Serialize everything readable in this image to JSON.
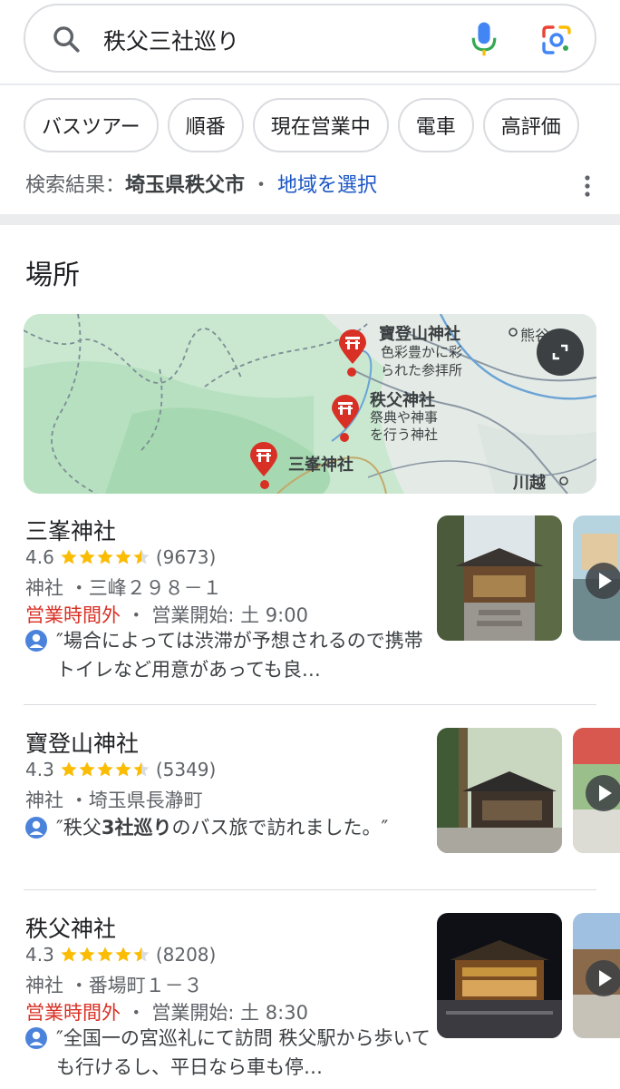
{
  "search": {
    "query": "秩父三社巡り"
  },
  "chips": [
    "バスツアー",
    "順番",
    "現在営業中",
    "電車",
    "高評価"
  ],
  "results_line": {
    "prefix": "検索結果：",
    "location": "埼玉県秩父市",
    "dot": "・",
    "link": "地域を選択"
  },
  "section_title": "場所",
  "map": {
    "pins": [
      {
        "name": "寶登山神社",
        "desc1": "色彩豊かに彩",
        "desc2": "られた参拝所"
      },
      {
        "name": "秩父神社",
        "desc1": "祭典や神事",
        "desc2": "を行う神社"
      },
      {
        "name": "三峯神社",
        "desc1": "",
        "desc2": ""
      }
    ],
    "labels": {
      "kumagaya": "熊谷",
      "kawagoe": "川越"
    },
    "colors": {
      "land": "#c9e8cf",
      "forest": "#a8dbb3",
      "urban": "#e6ece9",
      "pin": "#d93025"
    }
  },
  "listings": [
    {
      "name": "三峯神社",
      "rating": "4.6",
      "stars": 4.5,
      "count": "(9673)",
      "category": "神社",
      "sep": "・",
      "address": "三峰２９８－１",
      "status": "営業時間外",
      "hours_sep": "・",
      "hours": "営業開始: 土 9:00",
      "review": "″場合によっては渋滞が予想されるので携帯トイレなど用意があっても良…"
    },
    {
      "name": "寶登山神社",
      "rating": "4.3",
      "stars": 4.5,
      "count": "(5349)",
      "category": "神社",
      "sep": "・",
      "address": "埼玉県長瀞町",
      "status": "",
      "hours_sep": "",
      "hours": "",
      "review_pre": "″秩父",
      "review_bold": "3社巡り",
      "review_post": "のバス旅で訪れました。″"
    },
    {
      "name": "秩父神社",
      "rating": "4.3",
      "stars": 4.5,
      "count": "(8208)",
      "category": "神社",
      "sep": "・",
      "address": "番場町１－３",
      "status": "営業時間外",
      "hours_sep": "・",
      "hours": "営業開始: 土 8:30",
      "review": "″全国一の宮巡礼にて訪問 秩父駅から歩いても行けるし、平日なら車も停…"
    }
  ],
  "colors": {
    "star": "#fbbc04",
    "closed": "#d93025",
    "link": "#1a56c5"
  }
}
